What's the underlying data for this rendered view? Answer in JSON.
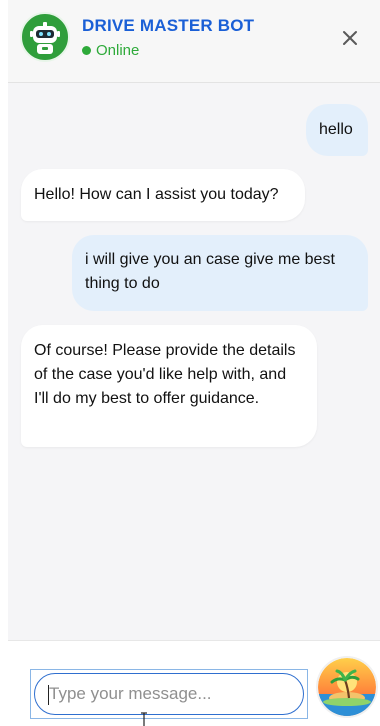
{
  "header": {
    "title": "DRIVE MASTER BOT",
    "status": "Online",
    "close_icon": "close-icon",
    "avatar_icon": "robot-icon"
  },
  "messages": [
    {
      "role": "user",
      "text": "hello"
    },
    {
      "role": "bot",
      "text": "Hello! How can I assist you today?"
    },
    {
      "role": "user",
      "text": "i will give you an case give me best thing to do"
    },
    {
      "role": "bot",
      "text": "Of course! Please provide the details of the case you'd like help with, and I'll do my best to offer guidance."
    }
  ],
  "composer": {
    "placeholder": "Type your message...",
    "value": "",
    "send_icon": "island-sunset-icon"
  },
  "colors": {
    "brand_blue": "#1a5fd6",
    "online_green": "#2eaa3a",
    "user_bubble": "#e3effb",
    "bot_bubble": "#ffffff",
    "chat_background": "#f5f5f7"
  }
}
